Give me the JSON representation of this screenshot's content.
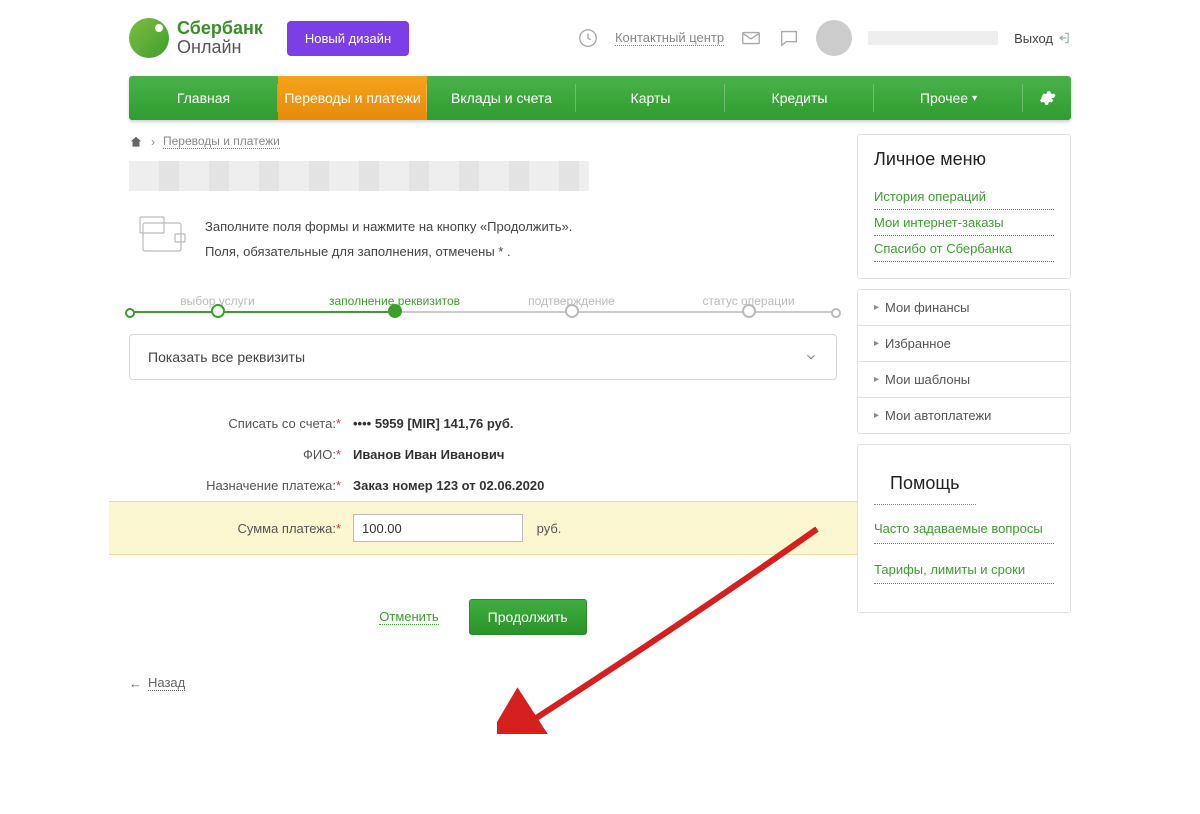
{
  "header": {
    "logo_line1": "Сбербанк",
    "logo_line2": "Онлайн",
    "new_design_button": "Новый дизайн",
    "contact_center": "Контактный центр",
    "logout": "Выход"
  },
  "nav": {
    "items": [
      "Главная",
      "Переводы и платежи",
      "Вклады и счета",
      "Карты",
      "Кредиты",
      "Прочее"
    ]
  },
  "breadcrumb": {
    "current": "Переводы и платежи"
  },
  "intro": {
    "line1": "Заполните поля формы и нажмите на кнопку «Продолжить».",
    "line2": "Поля, обязательные для заполнения, отмечены * ."
  },
  "steps": [
    "выбор услуги",
    "заполнение реквизитов",
    "подтверждение",
    "статус операции"
  ],
  "expand": "Показать все реквизиты",
  "form": {
    "account_label": "Списать со счета:",
    "account_value": "•••• 5959  [MIR] 141,76  руб.",
    "fio_label": "ФИО:",
    "fio_value": "Иванов Иван Иванович",
    "purpose_label": "Назначение платежа:",
    "purpose_value": "Заказ номер 123 от 02.06.2020",
    "amount_label": "Сумма платежа:",
    "amount_value": "100.00",
    "amount_suffix": "руб."
  },
  "actions": {
    "cancel": "Отменить",
    "continue": "Продолжить",
    "back": "Назад"
  },
  "sidebar": {
    "personal_menu_title": "Личное меню",
    "links": [
      "История операций",
      "Мои интернет-заказы",
      "Спасибо от Сбербанка"
    ],
    "accordion": [
      "Мои финансы",
      "Избранное",
      "Мои шаблоны",
      "Мои автоплатежи"
    ],
    "help_title": "Помощь",
    "help_links": [
      "Часто задаваемые вопросы",
      "Тарифы, лимиты и сроки"
    ]
  }
}
